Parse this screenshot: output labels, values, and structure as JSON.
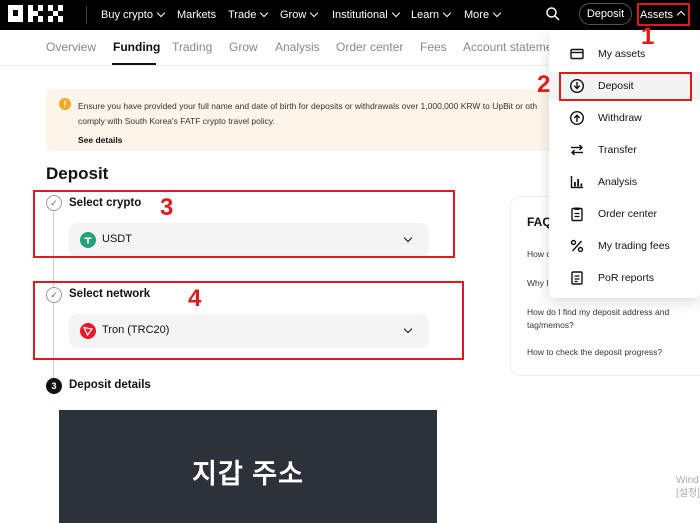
{
  "topbar": {
    "logo": "OKX",
    "nav": [
      {
        "label": "Buy crypto",
        "has_chevron": true
      },
      {
        "label": "Markets",
        "has_chevron": false
      },
      {
        "label": "Trade",
        "has_chevron": true
      },
      {
        "label": "Grow",
        "has_chevron": true
      },
      {
        "label": "Institutional",
        "has_chevron": true
      },
      {
        "label": "Learn",
        "has_chevron": true
      },
      {
        "label": "More",
        "has_chevron": true
      }
    ],
    "search_icon": "search-icon",
    "deposit_button": "Deposit",
    "assets_button": "Assets"
  },
  "subnav": {
    "tabs": [
      "Overview",
      "Funding",
      "Trading",
      "Grow",
      "Analysis",
      "Order center",
      "Fees",
      "Account stateme"
    ],
    "active": "Funding"
  },
  "notice": {
    "line1": "Ensure you have provided your full name and date of birth for deposits or withdrawals over 1,000,000 KRW to UpBit or oth",
    "line2": "comply with South Korea's FATF crypto travel policy.",
    "link": "See details",
    "accent": "#f5a623"
  },
  "page": {
    "title": "Deposit",
    "steps": [
      {
        "number": "✓",
        "label": "Select crypto",
        "value": "USDT",
        "coin_color": "#26a17b"
      },
      {
        "number": "✓",
        "label": "Select network",
        "value": "Tron (TRC20)",
        "coin_color": "#e8172c"
      },
      {
        "number": "3",
        "label": "Deposit details"
      }
    ],
    "wallet_panel_text": "지갑 주소"
  },
  "faq": {
    "title": "FAQ",
    "items": [
      "How c",
      "Why I",
      "How do I find my deposit address and tag/memos?",
      "How to check the deposit progress?"
    ]
  },
  "dropdown": {
    "items": [
      {
        "label": "My assets",
        "icon": "wallet-icon"
      },
      {
        "label": "Deposit",
        "icon": "deposit-icon"
      },
      {
        "label": "Withdraw",
        "icon": "withdraw-icon"
      },
      {
        "label": "Transfer",
        "icon": "transfer-icon"
      },
      {
        "label": "Analysis",
        "icon": "analysis-icon"
      },
      {
        "label": "Order center",
        "icon": "order-center-icon"
      },
      {
        "label": "My trading fees",
        "icon": "percent-icon"
      },
      {
        "label": "PoR reports",
        "icon": "report-icon"
      }
    ],
    "highlighted": "Deposit"
  },
  "annotations": {
    "numbers": [
      "1",
      "2",
      "3",
      "4"
    ],
    "color": "#e01a1a"
  },
  "watermark": {
    "line1": "Wind",
    "line2": "[설정]"
  }
}
